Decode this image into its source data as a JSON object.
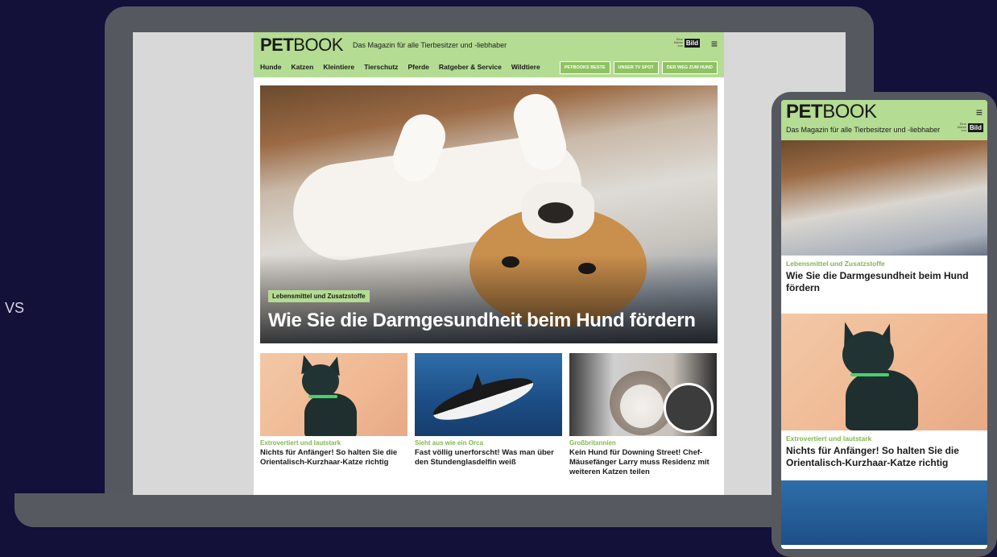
{
  "edge": {
    "fragment_top": "",
    "fragment_mid": "VS"
  },
  "site": {
    "logo_bold": "PET",
    "logo_light": "BOOK",
    "tagline": "Das Magazin für alle Tierbesitzer und -liebhaber",
    "brand_small": "Eine Marke von",
    "brand_bild": "Bild",
    "menu_icon": "≡"
  },
  "nav": {
    "items": [
      "Hunde",
      "Katzen",
      "Kleintiere",
      "Tierschutz",
      "Pferde",
      "Ratgeber & Service",
      "Wildtiere"
    ],
    "pills": [
      "PETBOOKS BESTE",
      "UNSER TV SPOT",
      "DER WEG ZUM HUND"
    ]
  },
  "hero": {
    "kicker": "Lebensmittel und Zusatzstoffe",
    "title": "Wie Sie die Darmgesundheit beim Hund fördern"
  },
  "cards": [
    {
      "kicker": "Extrovertiert und lautstark",
      "title": "Nichts für Anfänger! So halten Sie die Orientalisch-Kurzhaar-Katze richtig"
    },
    {
      "kicker": "Sieht aus wie ein Orca",
      "title": "Fast völlig unerforscht! Was man über den Stundenglasdelfin weiß"
    },
    {
      "kicker": "Großbritannien",
      "title": "Kein Hund für Downing Street! Chef-Mäusefänger Larry muss Residenz mit weiteren Katzen teilen"
    }
  ],
  "mobile": {
    "article1": {
      "kicker": "Lebensmittel und Zusatzstoffe",
      "title": "Wie Sie die Darmgesundheit beim Hund fördern"
    },
    "article2": {
      "kicker": "Extrovertiert und lautstark",
      "title": "Nichts für Anfänger! So halten Sie die Orientalisch-Kurzhaar-Katze richtig"
    }
  },
  "colors": {
    "brand_green": "#b4dc93",
    "accent_green": "#7fb850",
    "background": "#13103a",
    "device": "#55585f"
  }
}
